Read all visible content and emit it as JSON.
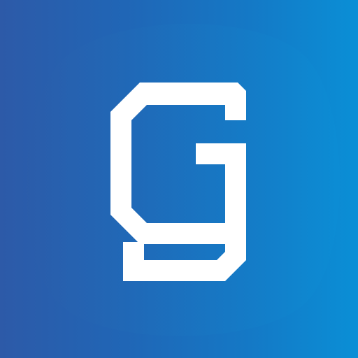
{
  "icon": {
    "name": "g-logo-icon",
    "gradient_start": "#2d5aa8",
    "gradient_end": "#0a8fd6",
    "glyph_color": "#ffffff"
  }
}
